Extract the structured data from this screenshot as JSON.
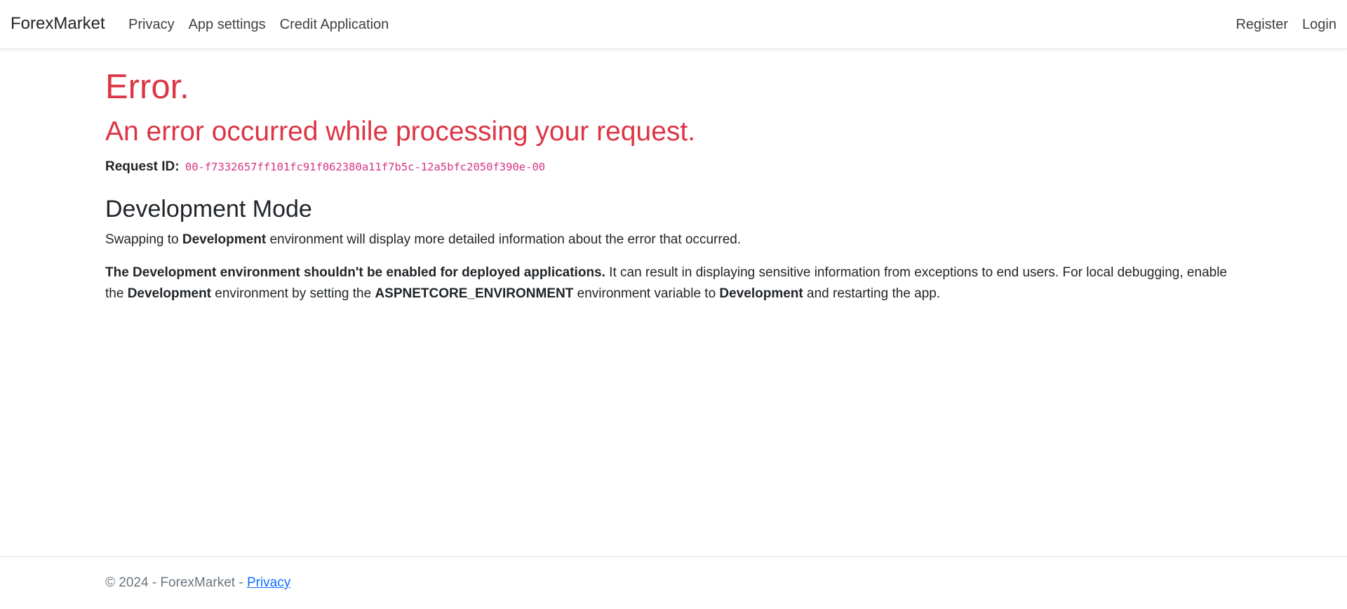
{
  "navbar": {
    "brand": "ForexMarket",
    "left_links": [
      "Privacy",
      "App settings",
      "Credit Application"
    ],
    "right_links": [
      "Register",
      "Login"
    ]
  },
  "error": {
    "title": "Error.",
    "subtitle": "An error occurred while processing your request.",
    "request_label": "Request ID:",
    "request_id": "00-f7332657ff101fc91f062380a11f7b5c-12a5bfc2050f390e-00"
  },
  "dev": {
    "heading": "Development Mode",
    "p1_before": "Swapping to ",
    "p1_bold": "Development",
    "p1_after": " environment will display more detailed information about the error that occurred.",
    "p2_bold1": "The Development environment shouldn't be enabled for deployed applications.",
    "p2_text1": " It can result in displaying sensitive information from exceptions to end users. For local debugging, enable the ",
    "p2_bold2": "Development",
    "p2_text2": " environment by setting the ",
    "p2_bold3": "ASPNETCORE_ENVIRONMENT",
    "p2_text3": " environment variable to ",
    "p2_bold4": "Development",
    "p2_text4": " and restarting the app."
  },
  "footer": {
    "text": "© 2024 - ForexMarket - ",
    "privacy_link": "Privacy"
  },
  "colors": {
    "error_red": "#dc3545",
    "code_pink": "#d63384",
    "link_blue": "#0d6efd",
    "muted": "#6c757d"
  }
}
